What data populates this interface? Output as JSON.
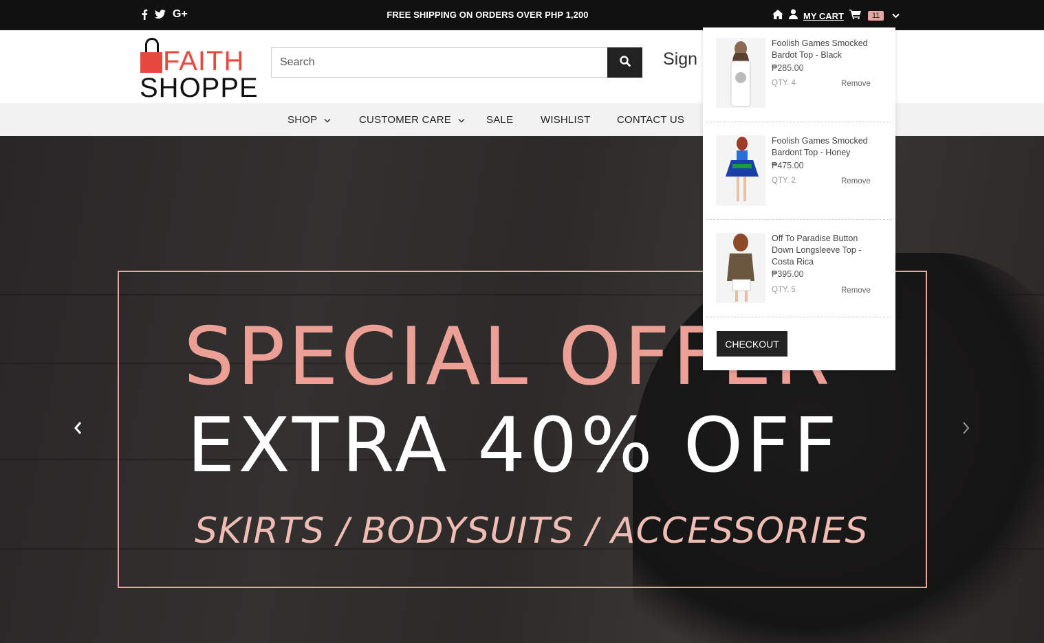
{
  "topbar": {
    "social": [
      {
        "icon": "facebook-icon",
        "glyph": "f"
      },
      {
        "icon": "twitter-icon",
        "glyph": ""
      },
      {
        "icon": "google-plus-icon",
        "glyph": "G+"
      }
    ],
    "promo": "FREE SHIPPING ON ORDERS OVER PHP 1,200",
    "my_cart_label": "MY CART",
    "cart_count": "11"
  },
  "header": {
    "logo_line1": "FAITH",
    "logo_line2": "SHOPPE",
    "search_placeholder": "Search",
    "signin_label": "Sign Up"
  },
  "nav": {
    "items": [
      {
        "label": "SHOP",
        "has_dropdown": true
      },
      {
        "label": "CUSTOMER CARE",
        "has_dropdown": true
      },
      {
        "label": "SALE",
        "has_dropdown": false
      },
      {
        "label": "WISHLIST",
        "has_dropdown": false
      },
      {
        "label": "CONTACT US",
        "has_dropdown": false
      }
    ]
  },
  "hero": {
    "line1": "SPECIAL OFFER",
    "line2": "EXTRA 40% OFF",
    "line3": "SKIRTS / BODYSUITS / ACCESSORIES"
  },
  "cart": {
    "items": [
      {
        "name": "Foolish Games Smocked Bardot Top - Black",
        "price": "₱285.00",
        "qty": "QTY. 4",
        "remove": "Remove"
      },
      {
        "name": "Foolish Games Smocked Bardont Top - Honey",
        "price": "₱475.00",
        "qty": "QTY. 2",
        "remove": "Remove"
      },
      {
        "name": "Off To Paradise Button Down Longsleeve Top - Costa Rica",
        "price": "₱395.00",
        "qty": "QTY. 5",
        "remove": "Remove"
      }
    ],
    "checkout_label": "CHECKOUT"
  },
  "colors": {
    "topbar_bg": "#111111",
    "accent_red": "#e8493f",
    "offer_pink": "#ec9f95",
    "nav_bg": "#f1f2f1"
  }
}
